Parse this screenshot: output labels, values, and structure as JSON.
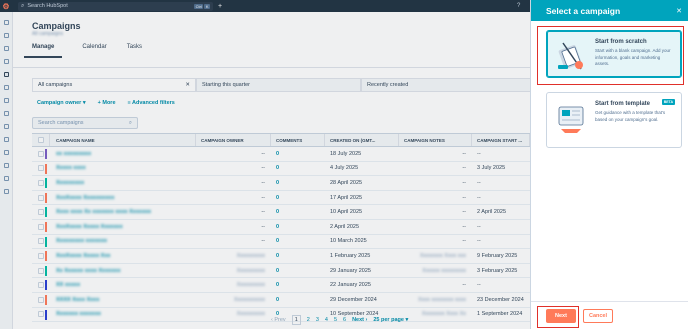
{
  "topbar": {
    "search_placeholder": "Search HubSpot",
    "kbd": [
      "Ctrl",
      "K"
    ],
    "plus": "+"
  },
  "page": {
    "title": "Campaigns",
    "subtitle": "All campaigns",
    "tabs": [
      {
        "label": "Manage"
      },
      {
        "label": "Calendar"
      },
      {
        "label": "Tasks"
      }
    ]
  },
  "views": [
    {
      "label": "All campaigns"
    },
    {
      "label": "Starting this quarter"
    },
    {
      "label": "Recently created"
    }
  ],
  "filters": {
    "owner": "Campaign owner",
    "more": "More",
    "advanced": "Advanced filters"
  },
  "search": {
    "placeholder": "Search campaigns"
  },
  "table": {
    "headers": [
      "CAMPAIGN NAME",
      "CAMPAIGN OWNER",
      "COMMENTS",
      "CREATED ON (GMT...",
      "CAMPAIGN NOTES",
      "CAMPAIGN START ..."
    ],
    "rows": [
      {
        "name": "xx xxxxxxxxx",
        "color": "#7b5ec6",
        "owner": "--",
        "comments": "0",
        "created": "18 July 2025",
        "notes": "--",
        "start": "--"
      },
      {
        "name": "Xxxxx xxxx",
        "color": "#ff7a59",
        "owner": "--",
        "comments": "0",
        "created": "4 July 2025",
        "notes": "--",
        "start": "3 July 2025"
      },
      {
        "name": "Xxxxxxxxx",
        "color": "#00bda5",
        "owner": "--",
        "comments": "0",
        "created": "28 April 2025",
        "notes": "--",
        "start": "--"
      },
      {
        "name": "XxxXxxxx Xxxxxxxxxx",
        "color": "#ff7a59",
        "owner": "--",
        "comments": "0",
        "created": "17 April 2025",
        "notes": "--",
        "start": "--"
      },
      {
        "name": "Xxxx xxxx Xx xxxxxxx xxxx Xxxxxxx",
        "color": "#00bda5",
        "owner": "--",
        "comments": "0",
        "created": "10 April 2025",
        "notes": "--",
        "start": "2 April 2025"
      },
      {
        "name": "XxxXxxxx Xxxxx Xxxxxxx",
        "color": "#ff7a59",
        "owner": "--",
        "comments": "0",
        "created": "2 April 2025",
        "notes": "--",
        "start": "--"
      },
      {
        "name": "Xxxxxxxxx xxxxxxx",
        "color": "#00bda5",
        "owner": "--",
        "comments": "0",
        "created": "10 March 2025",
        "notes": "--",
        "start": "--"
      },
      {
        "name": "XxxXxxxx Xxxxx Xxx",
        "color": "#ff7a59",
        "owner": "Xxxxxxxxxx",
        "comments": "0",
        "created": "1 February 2025",
        "notes": "Xxxxxxxx Xxxx xxx",
        "start": "9 February 2025"
      },
      {
        "name": "Xx Xxxxxx xxxx Xxxxxxx",
        "color": "#00bda5",
        "owner": "Xxxxxxxxxx",
        "comments": "0",
        "created": "29 January 2025",
        "notes": "Xxxxxx xxxxxxxxx",
        "start": "3 February 2025"
      },
      {
        "name": "XX xxxxx",
        "color": "#2a3fd6",
        "owner": "Xxxxxxxxxx",
        "comments": "0",
        "created": "22 January 2025",
        "notes": "--",
        "start": "--"
      },
      {
        "name": "XXXX Xxxx Xxxx",
        "color": "#ff7a59",
        "owner": "Xxxxxxxxxxx",
        "comments": "0",
        "created": "29 December 2024",
        "notes": "Xxxx xxxxxxxx xxxx",
        "start": "23 December 2024"
      },
      {
        "name": "Xxxxxxx xxxxxxx",
        "color": "#2a3fd6",
        "owner": "Xxxxxxxxxx",
        "comments": "0",
        "created": "10 September 2024",
        "notes": "Xxxxxxxx Xxxx Xx",
        "start": "1 September 2024"
      }
    ]
  },
  "pager": {
    "prev": "Prev",
    "pages": [
      "1",
      "2",
      "3",
      "4",
      "5",
      "6"
    ],
    "current": "1",
    "next": "Next",
    "per_page": "25 per page"
  },
  "panel": {
    "title": "Select a campaign",
    "close": "✕",
    "options": [
      {
        "title": "Start from scratch",
        "desc": "Start with a blank campaign. Add your information, goals and marketing assets.",
        "selected": true
      },
      {
        "title": "Start from template",
        "desc": "Get guidance with a template that's based on your campaign's goal.",
        "badge": "BETA"
      }
    ],
    "next": "Next",
    "cancel": "Cancel"
  },
  "colors": {
    "accent": "#00a4bd",
    "primary_button": "#ff7a59",
    "dark": "#213343",
    "highlight": "#e0302a"
  }
}
